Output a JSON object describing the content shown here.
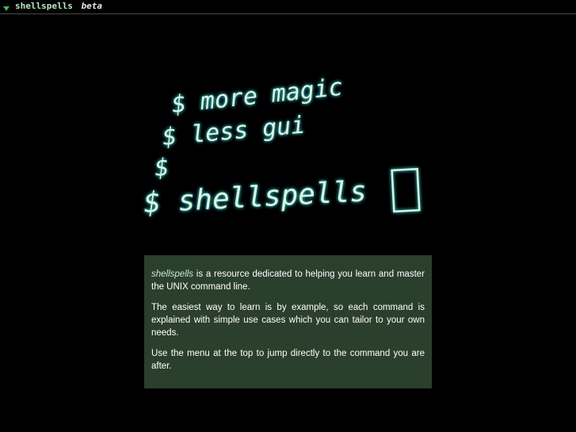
{
  "header": {
    "brand": "shellspells",
    "badge": "beta",
    "menu_icon": "triangle-down-icon",
    "accent_color": "#4caf50"
  },
  "hero": {
    "lines": [
      "$ more magic",
      "$ less gui",
      "$",
      "$ shellspells"
    ],
    "cursor_icon": "block-cursor-icon",
    "text_color": "#d8f8dc",
    "glow_color": "#2fa8b8"
  },
  "intro": {
    "p1_em": "shellspells",
    "p1_rest": " is a resource dedicated to helping you learn and master the UNIX command line.",
    "p2": "The easiest way to learn is by example, so each command is explained with simple use cases which you can tailor to your own needs.",
    "p3": "Use the menu at the top to jump directly to the command you are after."
  },
  "colors": {
    "background": "#000000",
    "panel": "#2b3f2d",
    "panel_text": "#ffffff"
  }
}
